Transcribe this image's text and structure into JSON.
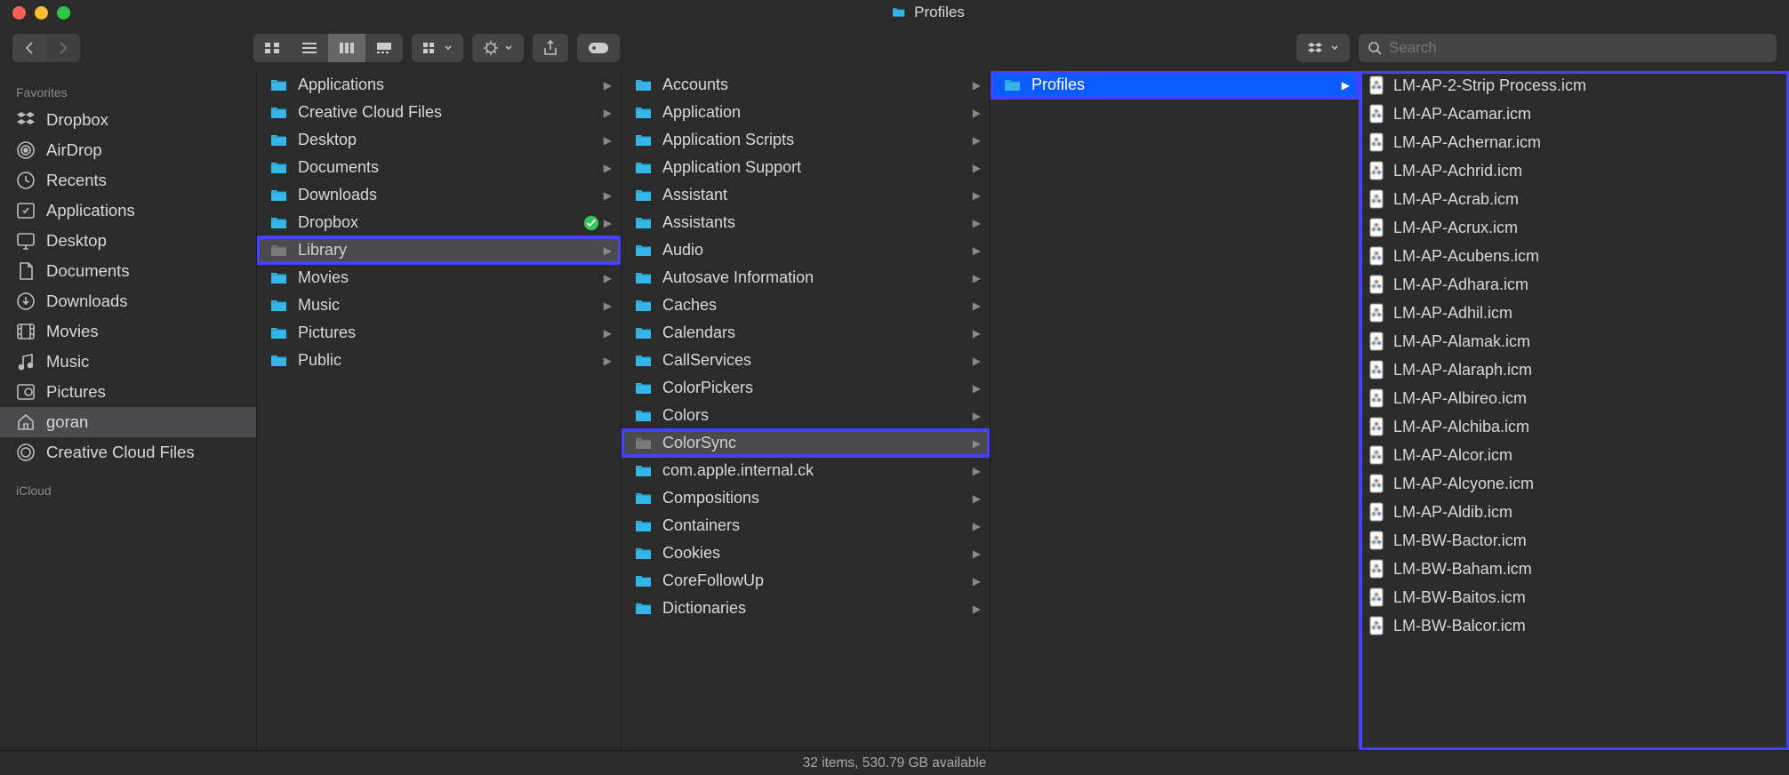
{
  "title": "Profiles",
  "search_placeholder": "Search",
  "sidebar": {
    "header": "Favorites",
    "items": [
      {
        "label": "Dropbox",
        "icon": "dropbox"
      },
      {
        "label": "AirDrop",
        "icon": "airdrop"
      },
      {
        "label": "Recents",
        "icon": "clock"
      },
      {
        "label": "Applications",
        "icon": "apps"
      },
      {
        "label": "Desktop",
        "icon": "desktop"
      },
      {
        "label": "Documents",
        "icon": "document"
      },
      {
        "label": "Downloads",
        "icon": "download"
      },
      {
        "label": "Movies",
        "icon": "movies"
      },
      {
        "label": "Music",
        "icon": "music"
      },
      {
        "label": "Pictures",
        "icon": "pictures"
      },
      {
        "label": "goran",
        "icon": "home",
        "selected": true
      },
      {
        "label": "Creative Cloud Files",
        "icon": "cc"
      }
    ],
    "header2": "iCloud"
  },
  "columns": [
    {
      "items": [
        {
          "label": "Applications",
          "nav": true
        },
        {
          "label": "Creative Cloud Files",
          "nav": true
        },
        {
          "label": "Desktop",
          "nav": true
        },
        {
          "label": "Documents",
          "nav": true
        },
        {
          "label": "Downloads",
          "nav": true
        },
        {
          "label": "Dropbox",
          "nav": true,
          "badge": "check"
        },
        {
          "label": "Library",
          "nav": true,
          "selected": true,
          "highlight": true
        },
        {
          "label": "Movies",
          "nav": true
        },
        {
          "label": "Music",
          "nav": true
        },
        {
          "label": "Pictures",
          "nav": true
        },
        {
          "label": "Public",
          "nav": true
        }
      ]
    },
    {
      "items": [
        {
          "label": "Accounts",
          "nav": true
        },
        {
          "label": "Application",
          "nav": true
        },
        {
          "label": "Application Scripts",
          "nav": true
        },
        {
          "label": "Application Support",
          "nav": true
        },
        {
          "label": "Assistant",
          "nav": true
        },
        {
          "label": "Assistants",
          "nav": true
        },
        {
          "label": "Audio",
          "nav": true
        },
        {
          "label": "Autosave Information",
          "nav": true
        },
        {
          "label": "Caches",
          "nav": true
        },
        {
          "label": "Calendars",
          "nav": true
        },
        {
          "label": "CallServices",
          "nav": true
        },
        {
          "label": "ColorPickers",
          "nav": true
        },
        {
          "label": "Colors",
          "nav": true
        },
        {
          "label": "ColorSync",
          "nav": true,
          "selected": true,
          "highlight": true
        },
        {
          "label": "com.apple.internal.ck",
          "nav": true
        },
        {
          "label": "Compositions",
          "nav": true
        },
        {
          "label": "Containers",
          "nav": true
        },
        {
          "label": "Cookies",
          "nav": true
        },
        {
          "label": "CoreFollowUp",
          "nav": true
        },
        {
          "label": "Dictionaries",
          "nav": true
        }
      ]
    },
    {
      "items": [
        {
          "label": "Profiles",
          "nav": true,
          "selected": true,
          "active": true,
          "highlight": true
        }
      ]
    },
    {
      "highlight": true,
      "items": [
        {
          "label": "LM-AP-2-Strip Process.icm",
          "type": "icm"
        },
        {
          "label": "LM-AP-Acamar.icm",
          "type": "icm"
        },
        {
          "label": "LM-AP-Achernar.icm",
          "type": "icm"
        },
        {
          "label": "LM-AP-Achrid.icm",
          "type": "icm"
        },
        {
          "label": "LM-AP-Acrab.icm",
          "type": "icm"
        },
        {
          "label": "LM-AP-Acrux.icm",
          "type": "icm"
        },
        {
          "label": "LM-AP-Acubens.icm",
          "type": "icm"
        },
        {
          "label": "LM-AP-Adhara.icm",
          "type": "icm"
        },
        {
          "label": "LM-AP-Adhil.icm",
          "type": "icm"
        },
        {
          "label": "LM-AP-Alamak.icm",
          "type": "icm"
        },
        {
          "label": "LM-AP-Alaraph.icm",
          "type": "icm"
        },
        {
          "label": "LM-AP-Albireo.icm",
          "type": "icm"
        },
        {
          "label": "LM-AP-Alchiba.icm",
          "type": "icm"
        },
        {
          "label": "LM-AP-Alcor.icm",
          "type": "icm"
        },
        {
          "label": "LM-AP-Alcyone.icm",
          "type": "icm"
        },
        {
          "label": "LM-AP-Aldib.icm",
          "type": "icm"
        },
        {
          "label": "LM-BW-Bactor.icm",
          "type": "icm"
        },
        {
          "label": "LM-BW-Baham.icm",
          "type": "icm"
        },
        {
          "label": "LM-BW-Baitos.icm",
          "type": "icm"
        },
        {
          "label": "LM-BW-Balcor.icm",
          "type": "icm"
        }
      ]
    }
  ],
  "status": "32 items, 530.79 GB available"
}
